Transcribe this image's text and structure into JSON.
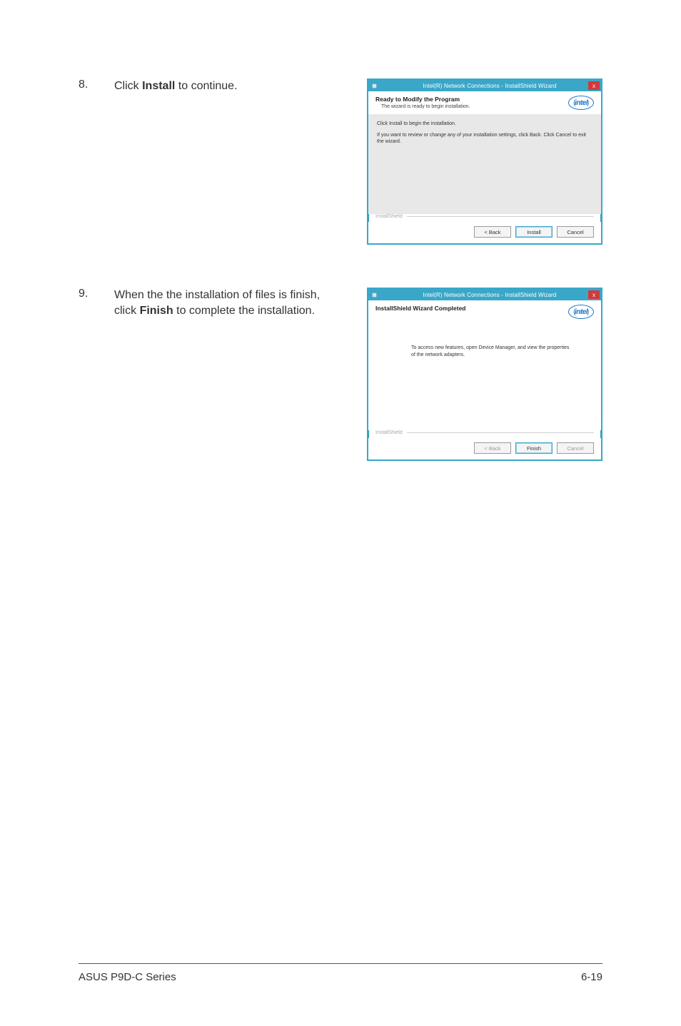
{
  "steps": {
    "s8": {
      "num": "8.",
      "text_pre": "Click ",
      "text_bold": "Install",
      "text_post": " to continue."
    },
    "s9": {
      "num": "9.",
      "text_pre": "When the the installation of files is finish, click ",
      "text_bold": "Finish",
      "text_post": " to complete the installation."
    }
  },
  "dialog1": {
    "title": "Intel(R) Network Connections - InstallShield Wizard",
    "close_glyph": "x",
    "head_bold": "Ready to Modify the Program",
    "head_sub": "The wizard is ready to begin installation.",
    "body_line1": "Click Install to begin the installation.",
    "body_line2": "If you want to review or change any of your installation settings, click Back. Click Cancel to exit the wizard.",
    "brand": "InstallShield",
    "intel": "intel",
    "buttons": {
      "back": "< Back",
      "install": "Install",
      "cancel": "Cancel"
    }
  },
  "dialog2": {
    "title": "Intel(R) Network Connections - InstallShield Wizard",
    "close_glyph": "x",
    "head_bold": "InstallShield Wizard Completed",
    "body_msg": "To access new features, open Device Manager, and view the properties of the network adapters.",
    "brand": "InstallShield",
    "intel": "intel",
    "buttons": {
      "back": "< Back",
      "finish": "Finish",
      "cancel": "Cancel"
    }
  },
  "footer": {
    "left": "ASUS P9D-C Series",
    "right": "6-19"
  }
}
